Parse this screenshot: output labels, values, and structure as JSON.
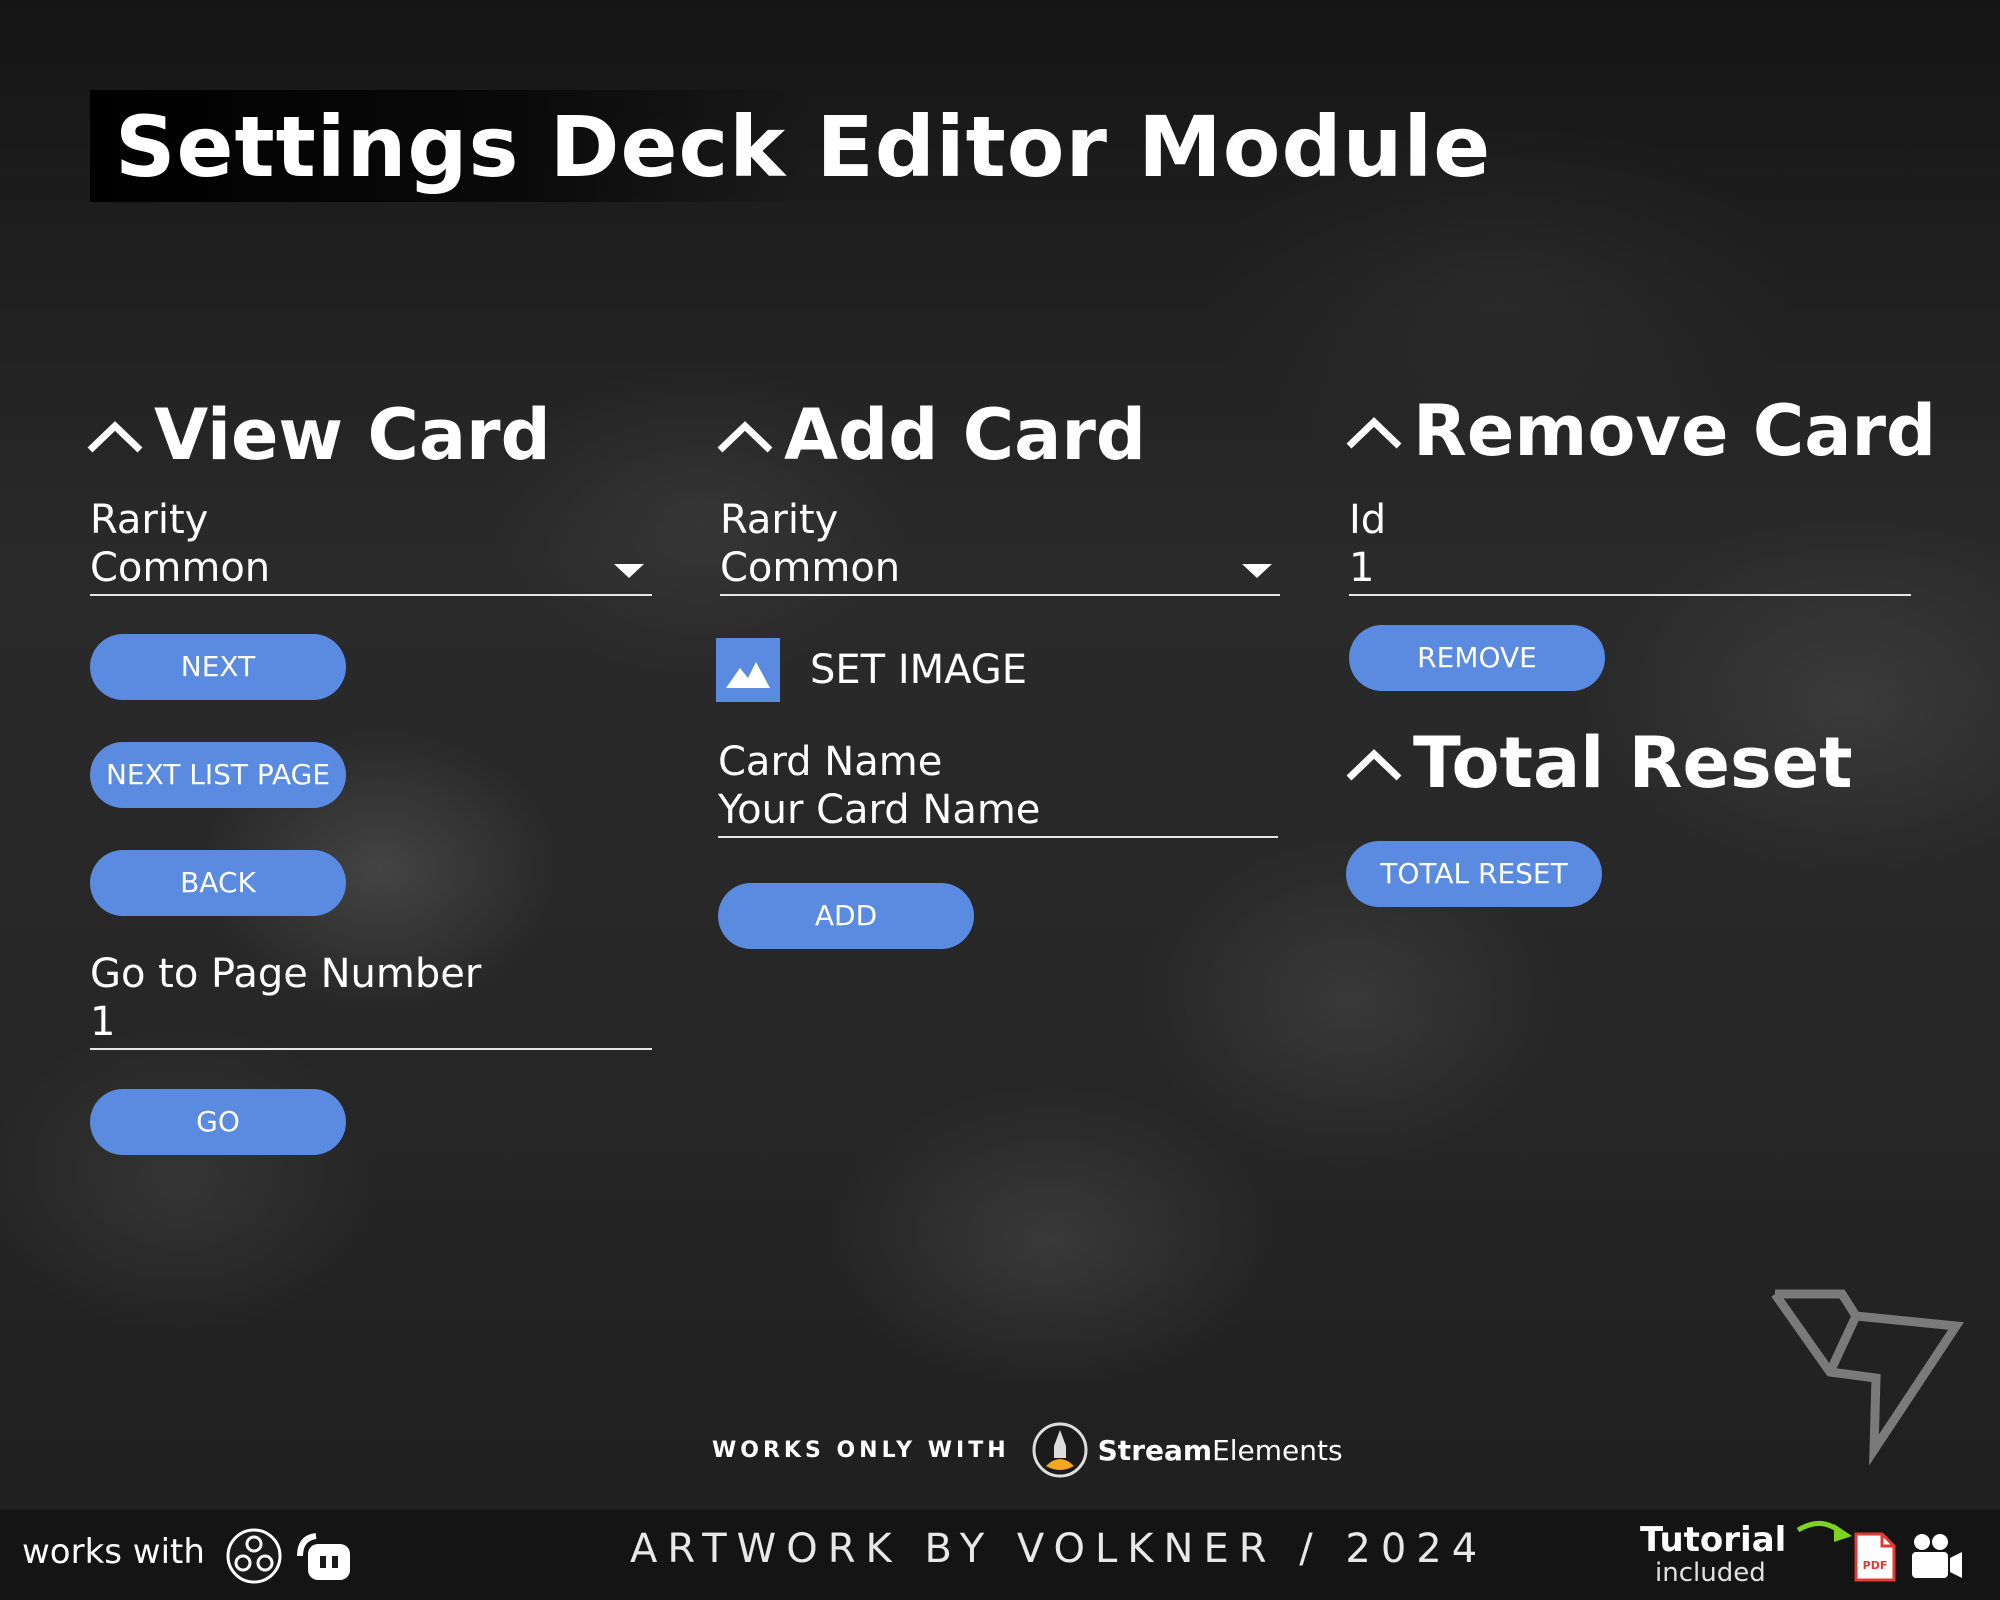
{
  "page": {
    "title": "Settings Deck Editor Module"
  },
  "view_card": {
    "heading": "View Card",
    "rarity_label": "Rarity",
    "rarity_value": "Common",
    "next_label": "NEXT",
    "next_list_page_label": "NEXT LIST PAGE",
    "back_label": "BACK",
    "goto_label": "Go to Page Number",
    "goto_value": "1",
    "go_label": "GO"
  },
  "add_card": {
    "heading": "Add Card",
    "rarity_label": "Rarity",
    "rarity_value": "Common",
    "set_image_label": "SET IMAGE",
    "card_name_label": "Card Name",
    "card_name_value": "Your Card Name",
    "add_label": "ADD"
  },
  "remove_card": {
    "heading": "Remove Card",
    "id_label": "Id",
    "id_value": "1",
    "remove_label": "REMOVE"
  },
  "total_reset": {
    "heading": "Total Reset",
    "button_label": "TOTAL RESET"
  },
  "promo": {
    "works_only_with": "WORKS ONLY WITH",
    "brand_bold": "Stream",
    "brand_rest": "Elements"
  },
  "footer": {
    "works_with": "works with",
    "artwork": "ARTWORK BY VOLKNER / 2024",
    "tutorial": "Tutorial",
    "included": "included",
    "pdf_badge": "PDF"
  },
  "icons": [
    "chevron-up-icon",
    "caret-down-icon",
    "image-icon",
    "streamelements-icon",
    "obs-icon",
    "streamlabs-icon",
    "arrow-icon",
    "pdf-icon",
    "video-icon",
    "volkner-logo"
  ],
  "colors": {
    "button": "#5a8be0",
    "background": "#222222",
    "text": "#ffffff",
    "arrow": "#7ed321",
    "pdf": "#e53935"
  }
}
